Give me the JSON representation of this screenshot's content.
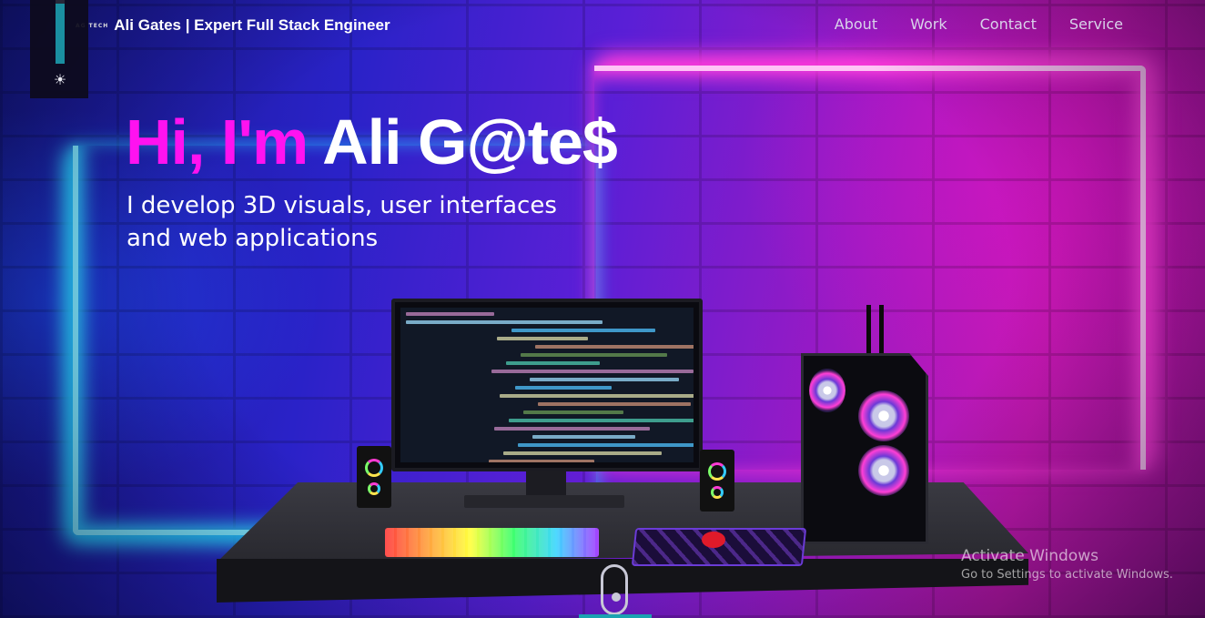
{
  "nav": {
    "brand_mini": "AG TECH",
    "brand_name": "Ali Gates  | Expert Full Stack Engineer",
    "links": [
      "About",
      "Work",
      "Contact",
      "Service"
    ]
  },
  "sidebar_control": {
    "level_fraction": 0.95,
    "icon": "sun-icon"
  },
  "hero": {
    "greeting": "Hi, I'm ",
    "name": "Ali G@te$",
    "subtitle": "I develop 3D visuals, user interfaces and web applications"
  },
  "colors": {
    "greeting": "#ff12f0",
    "neon_blue": "#7fe8ff",
    "neon_pink": "#ffc3f6",
    "slider_fill": "#1b9aa6"
  },
  "scroll_indicator": {
    "icon": "scroll-mouse-icon"
  },
  "watermark": {
    "title": "Activate Windows",
    "subtitle": "Go to Settings to activate Windows."
  }
}
